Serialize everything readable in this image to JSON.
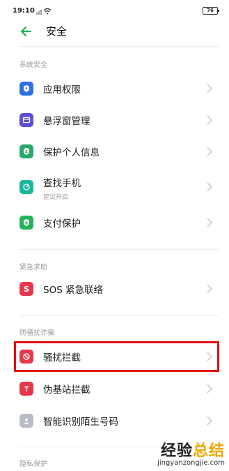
{
  "status_bar": {
    "time": "19:10",
    "battery": "76"
  },
  "header": {
    "title": "安全"
  },
  "sections": [
    {
      "label": "系统安全"
    },
    {
      "label": "紧急求助"
    },
    {
      "label": "防骚扰诈骗"
    },
    {
      "label": "隐私保护"
    }
  ],
  "items": [
    {
      "label": "应用权限",
      "icon": "shield-icon",
      "color": "#2f6fe8"
    },
    {
      "label": "悬浮窗管理",
      "icon": "window-icon",
      "color": "#5a4fd6"
    },
    {
      "label": "保护个人信息",
      "icon": "person-lock-icon",
      "color": "#2aa86a"
    },
    {
      "label": "查找手机",
      "sublabel": "建议开启",
      "icon": "locate-icon",
      "color": "#1ab89a"
    },
    {
      "label": "支付保护",
      "icon": "payment-shield-icon",
      "color": "#25b35a"
    },
    {
      "label": "SOS 紧急联络",
      "icon": "sos-icon",
      "color": "#e8364a"
    },
    {
      "label": "骚扰拦截",
      "icon": "block-icon",
      "color": "#e8364a"
    },
    {
      "label": "伪基站拦截",
      "icon": "signal-tower-icon",
      "color": "#e8364a"
    },
    {
      "label": "智能识别陌生号码",
      "icon": "contact-icon",
      "color": "#b8bcc4"
    }
  ],
  "watermark": {
    "title_a": "经验",
    "title_b": "总结",
    "url": "jingyanzongjie.com"
  }
}
